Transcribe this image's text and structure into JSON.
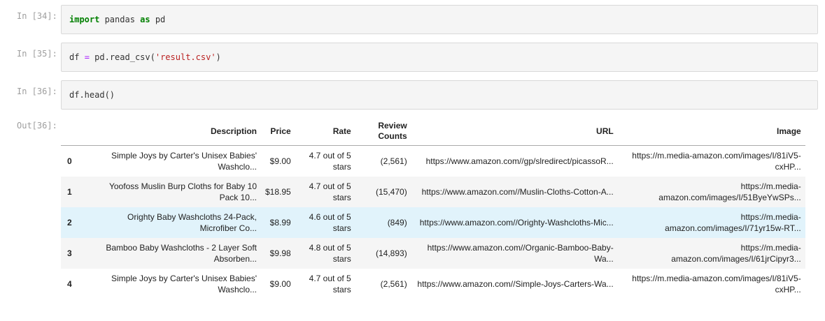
{
  "cells": [
    {
      "prompt": "In [34]:",
      "code": {
        "keyword1": "import",
        "text1": " pandas ",
        "keyword2": "as",
        "text2": " pd"
      }
    },
    {
      "prompt": "In [35]:",
      "code": {
        "text1": "df ",
        "op": "=",
        "text2": " pd.read_csv(",
        "str": "'result.csv'",
        "text3": ")"
      }
    },
    {
      "prompt": "In [36]:",
      "code": {
        "text1": "df.head()"
      }
    }
  ],
  "output": {
    "prompt": "Out[36]:",
    "columns": [
      "",
      "Description",
      "Price",
      "Rate",
      "Review Counts",
      "URL",
      "Image"
    ],
    "rows": [
      {
        "index": "0",
        "description": "Simple Joys by Carter's Unisex Babies' Washclo...",
        "price": "$9.00",
        "rate": "4.7 out of 5 stars",
        "reviews": "(2,561)",
        "url": "https://www.amazon.com//gp/slredirect/picassoR...",
        "image": "https://m.media-amazon.com/images/I/81iV5-cxHP..."
      },
      {
        "index": "1",
        "description": "Yoofoss Muslin Burp Cloths for Baby 10 Pack 10...",
        "price": "$18.95",
        "rate": "4.7 out of 5 stars",
        "reviews": "(15,470)",
        "url": "https://www.amazon.com//Muslin-Cloths-Cotton-A...",
        "image": "https://m.media-amazon.com/images/I/51ByeYwSPs..."
      },
      {
        "index": "2",
        "description": "Orighty Baby Washcloths 24-Pack, Microfiber Co...",
        "price": "$8.99",
        "rate": "4.6 out of 5 stars",
        "reviews": "(849)",
        "url": "https://www.amazon.com//Orighty-Washcloths-Mic...",
        "image": "https://m.media-amazon.com/images/I/71yr15w-RT..."
      },
      {
        "index": "3",
        "description": "Bamboo Baby Washcloths - 2 Layer Soft Absorben...",
        "price": "$9.98",
        "rate": "4.8 out of 5 stars",
        "reviews": "(14,893)",
        "url": "https://www.amazon.com//Organic-Bamboo-Baby-Wa...",
        "image": "https://m.media-amazon.com/images/I/61jrCipyr3..."
      },
      {
        "index": "4",
        "description": "Simple Joys by Carter's Unisex Babies' Washclo...",
        "price": "$9.00",
        "rate": "4.7 out of 5 stars",
        "reviews": "(2,561)",
        "url": "https://www.amazon.com//Simple-Joys-Carters-Wa...",
        "image": "https://m.media-amazon.com/images/I/81iV5-cxHP..."
      }
    ]
  }
}
